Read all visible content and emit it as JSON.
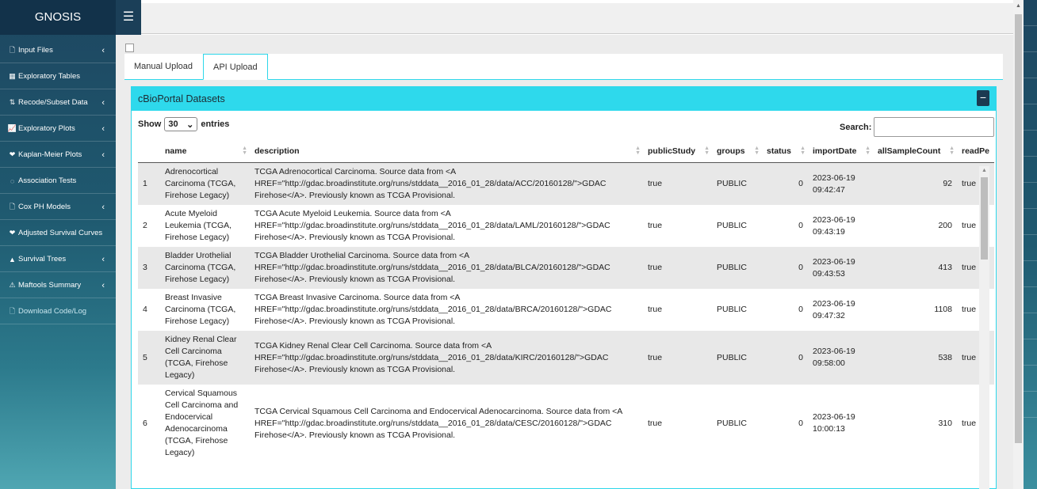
{
  "app": {
    "title": "GNOSIS",
    "menu_icon": "☰"
  },
  "sidebar": {
    "items": [
      {
        "label": "Input Files",
        "icon": "file-icon",
        "glyph": "🗋",
        "chevron": true
      },
      {
        "label": "Exploratory Tables",
        "icon": "table-icon",
        "glyph": "▦",
        "chevron": false
      },
      {
        "label": "Recode/Subset Data",
        "icon": "sort-icon",
        "glyph": "⇅",
        "chevron": true
      },
      {
        "label": "Exploratory Plots",
        "icon": "chart-icon",
        "glyph": "📈",
        "chevron": true
      },
      {
        "label": "Kaplan-Meier Plots",
        "icon": "heartbeat-icon",
        "glyph": "❤",
        "chevron": true
      },
      {
        "label": "Association Tests",
        "icon": "circle-icon",
        "glyph": "◌",
        "chevron": false
      },
      {
        "label": "Cox PH Models",
        "icon": "file-icon",
        "glyph": "🗋",
        "chevron": true
      },
      {
        "label": "Adjusted Survival Curves",
        "icon": "heartbeat-icon",
        "glyph": "❤",
        "chevron": false
      },
      {
        "label": "Survival Trees",
        "icon": "tree-icon",
        "glyph": "▲",
        "chevron": true
      },
      {
        "label": "Maftools Summary",
        "icon": "warning-icon",
        "glyph": "⚠",
        "chevron": true
      },
      {
        "label": "Download Code/Log",
        "icon": "file-icon",
        "glyph": "🗋",
        "chevron": false
      }
    ]
  },
  "tabs": [
    {
      "label": "Manual Upload",
      "active": false
    },
    {
      "label": "API Upload",
      "active": true
    }
  ],
  "panel": {
    "title": "cBioPortal Datasets",
    "collapse_glyph": "−",
    "show_label": "Show",
    "entries_value": "30",
    "entries_label": "entries",
    "search_label": "Search:"
  },
  "table": {
    "columns": [
      "",
      "name",
      "description",
      "publicStudy",
      "groups",
      "status",
      "importDate",
      "allSampleCount",
      "readPe"
    ],
    "rows": [
      {
        "idx": "1",
        "name": "Adrenocortical Carcinoma (TCGA, Firehose Legacy)",
        "description": "TCGA Adrenocortical Carcinoma. Source data from <A HREF=\"http://gdac.broadinstitute.org/runs/stddata__2016_01_28/data/ACC/20160128/\">GDAC Firehose</A>. Previously known as TCGA Provisional.",
        "publicStudy": "true",
        "groups": "PUBLIC",
        "status": "0",
        "importDate": "2023-06-19 09:42:47",
        "allSampleCount": "92",
        "readPe": "true"
      },
      {
        "idx": "2",
        "name": "Acute Myeloid Leukemia (TCGA, Firehose Legacy)",
        "description": "TCGA Acute Myeloid Leukemia. Source data from <A HREF=\"http://gdac.broadinstitute.org/runs/stddata__2016_01_28/data/LAML/20160128/\">GDAC Firehose</A>. Previously known as TCGA Provisional.",
        "publicStudy": "true",
        "groups": "PUBLIC",
        "status": "0",
        "importDate": "2023-06-19 09:43:19",
        "allSampleCount": "200",
        "readPe": "true"
      },
      {
        "idx": "3",
        "name": "Bladder Urothelial Carcinoma (TCGA, Firehose Legacy)",
        "description": "TCGA Bladder Urothelial Carcinoma. Source data from <A HREF=\"http://gdac.broadinstitute.org/runs/stddata__2016_01_28/data/BLCA/20160128/\">GDAC Firehose</A>. Previously known as TCGA Provisional.",
        "publicStudy": "true",
        "groups": "PUBLIC",
        "status": "0",
        "importDate": "2023-06-19 09:43:53",
        "allSampleCount": "413",
        "readPe": "true"
      },
      {
        "idx": "4",
        "name": "Breast Invasive Carcinoma (TCGA, Firehose Legacy)",
        "description": "TCGA Breast Invasive Carcinoma. Source data from <A HREF=\"http://gdac.broadinstitute.org/runs/stddata__2016_01_28/data/BRCA/20160128/\">GDAC Firehose</A>. Previously known as TCGA Provisional.",
        "publicStudy": "true",
        "groups": "PUBLIC",
        "status": "0",
        "importDate": "2023-06-19 09:47:32",
        "allSampleCount": "1108",
        "readPe": "true"
      },
      {
        "idx": "5",
        "name": "Kidney Renal Clear Cell Carcinoma (TCGA, Firehose Legacy)",
        "description": "TCGA Kidney Renal Clear Cell Carcinoma. Source data from <A HREF=\"http://gdac.broadinstitute.org/runs/stddata__2016_01_28/data/KIRC/20160128/\">GDAC Firehose</A>. Previously known as TCGA Provisional.",
        "publicStudy": "true",
        "groups": "PUBLIC",
        "status": "0",
        "importDate": "2023-06-19 09:58:00",
        "allSampleCount": "538",
        "readPe": "true"
      },
      {
        "idx": "6",
        "name": "Cervical Squamous Cell Carcinoma and Endocervical Adenocarcinoma (TCGA, Firehose Legacy)",
        "description": "TCGA Cervical Squamous Cell Carcinoma and Endocervical Adenocarcinoma. Source data from <A HREF=\"http://gdac.broadinstitute.org/runs/stddata__2016_01_28/data/CESC/20160128/\">GDAC Firehose</A>. Previously known as TCGA Provisional.",
        "publicStudy": "true",
        "groups": "PUBLIC",
        "status": "0",
        "importDate": "2023-06-19 10:00:13",
        "allSampleCount": "310",
        "readPe": "true"
      }
    ]
  },
  "colors": {
    "accent": "#2ed9ec",
    "sidebar": "#1d4660",
    "header": "#12324a"
  }
}
